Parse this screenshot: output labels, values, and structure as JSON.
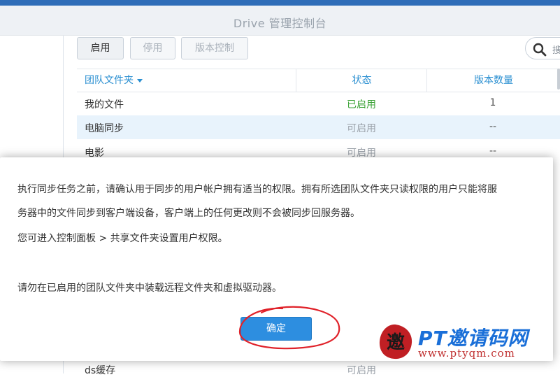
{
  "window": {
    "title": "Drive 管理控制台"
  },
  "toolbar": {
    "enable": "启用",
    "disable": "停用",
    "version_control": "版本控制"
  },
  "search": {
    "placeholder": "搜"
  },
  "grid": {
    "headers": {
      "folder": "团队文件夹",
      "status": "状态",
      "versions": "版本数量"
    },
    "rows": [
      {
        "name": "我的文件",
        "status": "已启用",
        "versions": "1"
      },
      {
        "name": "电脑同步",
        "status": "可启用",
        "versions": "--"
      },
      {
        "name": "电影",
        "status": "可启用",
        "versions": "--"
      }
    ],
    "bottom_row": {
      "name": "ds缓存",
      "status": "可启用"
    }
  },
  "dialog": {
    "line1": "执行同步任务之前，请确认用于同步的用户帐户拥有适当的权限。拥有所选团队文件夹只读权限的用户只能将服",
    "line2": "务器中的文件同步到客户端设备，客户端上的任何更改则不会被同步回服务器。",
    "line3": "您可进入控制面板 > 共享文件夹设置用户权限。",
    "line4": "请勿在已启用的团队文件夹中装载远程文件夹和虚拟驱动器。",
    "ok_button": "确定"
  },
  "watermark": {
    "brand": "PT邀请码网",
    "url": "www.ptyqm.com"
  },
  "colors": {
    "accent": "#2d8ee0",
    "enabled_status": "#3aa235",
    "annotation": "#e0222a"
  }
}
